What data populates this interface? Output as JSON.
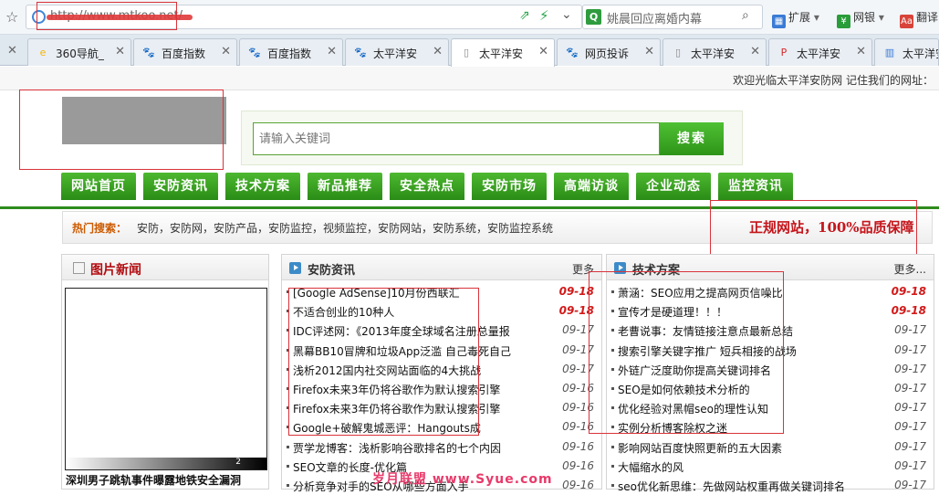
{
  "browser": {
    "url": "http://www.mtkoo.net/",
    "search_placeholder": "姚晨回应离婚内幕",
    "search_engine_badge": "Q",
    "extensions": [
      {
        "label": "扩展",
        "color": "#3a7bd5",
        "glyph": "▦"
      },
      {
        "label": "网银",
        "color": "#2a9d3a",
        "glyph": "¥"
      },
      {
        "label": "翻译",
        "color": "#d9443a",
        "glyph": "Aa"
      }
    ]
  },
  "tabs": [
    {
      "label": "360导航_",
      "icon": "360-icon",
      "color": "#f2b600",
      "glyph": "e"
    },
    {
      "label": "百度指数",
      "icon": "baidu-paw-icon",
      "color": "#2a5cd0",
      "glyph": "🐾"
    },
    {
      "label": "百度指数",
      "icon": "baidu-paw-icon",
      "color": "#2a5cd0",
      "glyph": "🐾"
    },
    {
      "label": "太平洋安",
      "icon": "baidu-paw-icon",
      "color": "#2a5cd0",
      "glyph": "🐾"
    },
    {
      "label": "太平洋安",
      "icon": "page-icon",
      "color": "#888888",
      "glyph": "▯",
      "active": true
    },
    {
      "label": "网页投诉",
      "icon": "baidu-paw-icon",
      "color": "#2a5cd0",
      "glyph": "🐾"
    },
    {
      "label": "太平洋安",
      "icon": "page-icon",
      "color": "#888888",
      "glyph": "▯"
    },
    {
      "label": "太平洋安",
      "icon": "pconline-icon",
      "color": "#d42b2b",
      "glyph": "P"
    },
    {
      "label": "太平洋安",
      "icon": "chart-icon",
      "color": "#3a7bd5",
      "glyph": "▥"
    }
  ],
  "welcome": "欢迎光临太平洋安防网  记住我们的网址：",
  "search": {
    "placeholder": "请输入关键词",
    "button": "搜索"
  },
  "nav": [
    "网站首页",
    "安防资讯",
    "技术方案",
    "新品推荐",
    "安全热点",
    "安防市场",
    "高端访谈",
    "企业动态",
    "监控资讯"
  ],
  "hot": {
    "label": "热门搜索：",
    "words": "安防，安防网，安防产品，安防监控，视频监控，安防网站，安防系统，安防监控系统",
    "slogan": "正规网站，100%品质保障"
  },
  "pic_news": {
    "title": "图片新闻",
    "caption": "深圳男子跳轨事件曝露地铁安全漏洞",
    "page": "2"
  },
  "news": {
    "title": "安防资讯",
    "more": "更多",
    "items": [
      {
        "title": "[Google AdSense]10月份西联汇",
        "date": "09-18",
        "hot": true
      },
      {
        "title": "不适合创业的10种人",
        "date": "09-18",
        "hot": true
      },
      {
        "title": "IDC评述网：《2013年度全球域名注册总量报",
        "date": "09-17"
      },
      {
        "title": "黑幕BB10冒牌和垃圾App泛滥 自己毒死自己",
        "date": "09-17"
      },
      {
        "title": "浅析2012国内社交网站面临的4大挑战",
        "date": "09-17"
      },
      {
        "title": "Firefox未来3年仍将谷歌作为默认搜索引擎",
        "date": "09-16"
      },
      {
        "title": "Firefox未来3年仍将谷歌作为默认搜索引擎",
        "date": "09-16"
      },
      {
        "title": "Google+破解鬼城恶评：Hangouts成",
        "date": "09-16"
      },
      {
        "title": "贾学龙博客：浅析影响谷歌排名的七个内因",
        "date": "09-16"
      },
      {
        "title": "SEO文章的长度-优化篇",
        "date": "09-16"
      },
      {
        "title": "分析竞争对手的SEO从哪些方面入手",
        "date": "09-16"
      }
    ]
  },
  "tech": {
    "title": "技术方案",
    "more": "更多...",
    "items": [
      {
        "title": "萧涵：SEO应用之提高网页信噪比",
        "date": "09-18",
        "hot": true
      },
      {
        "title": "宣传才是硬道理！！！",
        "date": "09-18",
        "hot": true
      },
      {
        "title": "老曹说事：友情链接注意点最新总结",
        "date": "09-17"
      },
      {
        "title": "搜索引擎关键字推广  短兵相接的战场",
        "date": "09-17"
      },
      {
        "title": "外链广泛度助你提高关键词排名",
        "date": "09-17"
      },
      {
        "title": "SEO是如何依赖技术分析的",
        "date": "09-17"
      },
      {
        "title": "优化经验对黑帽seo的理性认知",
        "date": "09-17"
      },
      {
        "title": "实例分析博客除权之迷",
        "date": "09-17"
      },
      {
        "title": "影响网站百度快照更新的五大因素",
        "date": "09-17"
      },
      {
        "title": "大幅缩水的风",
        "date": "09-17"
      },
      {
        "title": "seo优化新思维：先做网站权重再做关键词排名",
        "date": "09-17"
      }
    ]
  },
  "watermark": "岁月联盟 www.Syue.com"
}
